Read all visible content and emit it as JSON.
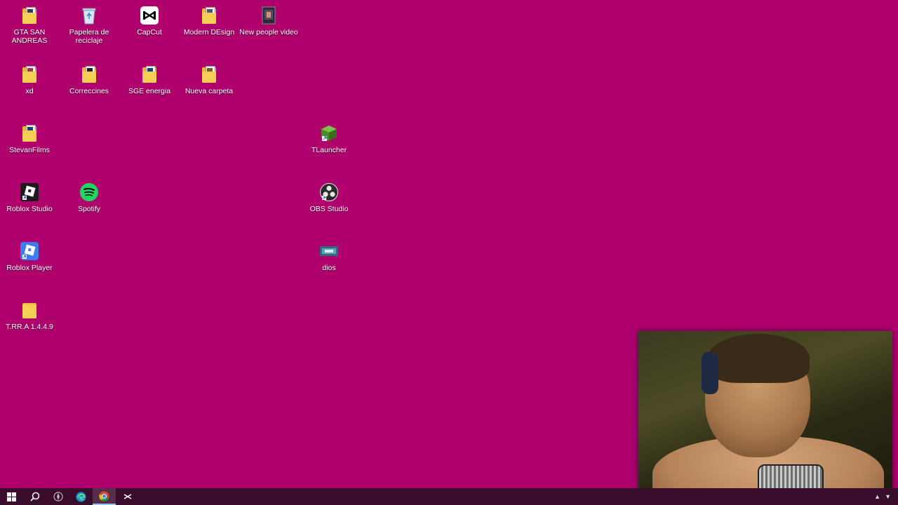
{
  "desktop": {
    "background_color": "#b0006e",
    "icons": [
      {
        "label": "GTA SAN ANDREAS",
        "icon": "folder-icon"
      },
      {
        "label": "Papelera de reciclaje",
        "icon": "recycle-bin-icon"
      },
      {
        "label": "CapCut",
        "icon": "capcut-icon"
      },
      {
        "label": "Modern DEsign",
        "icon": "folder-icon"
      },
      {
        "label": "New people video",
        "icon": "video-file-icon"
      },
      {
        "label": "xd",
        "icon": "folder-icon"
      },
      {
        "label": "Correccines",
        "icon": "folder-icon"
      },
      {
        "label": "SGE energia",
        "icon": "folder-icon"
      },
      {
        "label": "Nueva carpeta",
        "icon": "folder-icon"
      },
      {
        "label": "StevanFilms",
        "icon": "folder-icon"
      },
      {
        "label": "TLauncher",
        "icon": "tlauncher-icon"
      },
      {
        "label": "Roblox Studio",
        "icon": "roblox-studio-icon"
      },
      {
        "label": "Spotify",
        "icon": "spotify-icon"
      },
      {
        "label": "OBS Studio",
        "icon": "obs-icon"
      },
      {
        "label": "Roblox Player",
        "icon": "roblox-player-icon"
      },
      {
        "label": "dios",
        "icon": "image-file-icon"
      },
      {
        "label": "T.RR.A 1.4.4.9",
        "icon": "folder-icon"
      }
    ]
  },
  "taskbar": {
    "items": [
      "start-icon",
      "search-icon",
      "app-icon",
      "edge-icon",
      "chrome-icon",
      "capcut-icon"
    ],
    "active": "chrome-icon"
  }
}
